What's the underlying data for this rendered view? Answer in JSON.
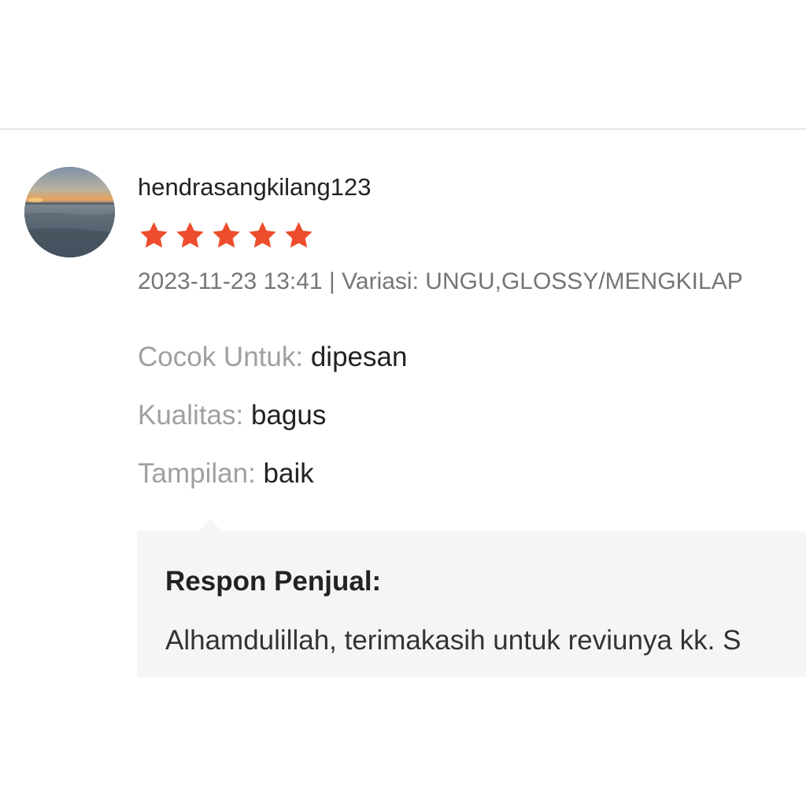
{
  "review": {
    "username": "hendrasangkilang123",
    "rating": 5,
    "rating_max": 5,
    "star_color": "#ee4d2d",
    "date": "2023-11-23 13:41",
    "separator": "|",
    "variation_label": "Variasi:",
    "variation_value": "UNGU,GLOSSY/MENGKILAP",
    "attributes": [
      {
        "label": "Cocok Untuk:",
        "value": "dipesan"
      },
      {
        "label": "Kualitas:",
        "value": "bagus"
      },
      {
        "label": "Tampilan:",
        "value": "baik"
      }
    ]
  },
  "seller_response": {
    "title": "Respon Penjual:",
    "text": "Alhamdulillah, terimakasih untuk reviunya kk. S"
  }
}
